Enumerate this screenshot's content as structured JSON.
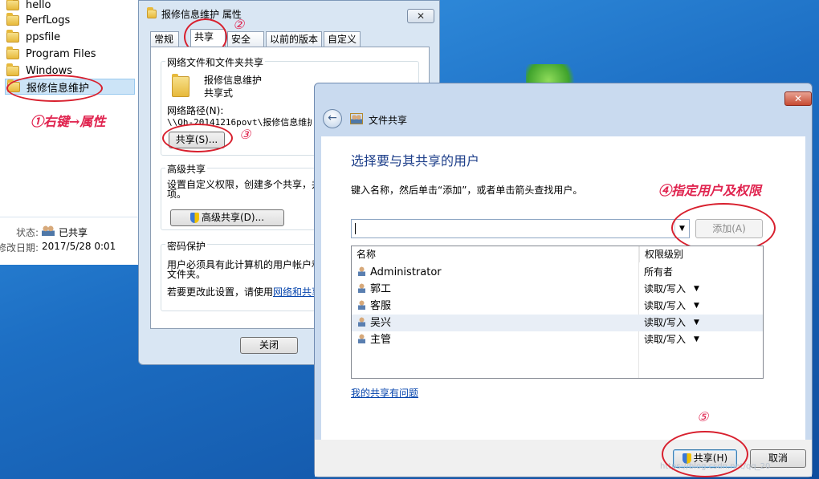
{
  "explorer": {
    "items": [
      {
        "label": "hello"
      },
      {
        "label": "PerfLogs"
      },
      {
        "label": "ppsfile"
      },
      {
        "label": "Program Files"
      },
      {
        "label": "Windows"
      },
      {
        "label": "报修信息维护"
      }
    ],
    "annotation_step1": "①右键→属性",
    "status_label": "状态:",
    "status_value": "已共享",
    "modified_label": "修改日期:",
    "modified_value": "2017/5/28 0:01"
  },
  "properties": {
    "title": "报修信息维护 属性",
    "close_x": "✕",
    "tabs": [
      {
        "label": "常规"
      },
      {
        "label": "共享"
      },
      {
        "label": "安全"
      },
      {
        "label": "以前的版本"
      },
      {
        "label": "自定义"
      }
    ],
    "annotation_step2": "②",
    "network_group_title": "网络文件和文件夹共享",
    "folder_name": "报修信息维护",
    "folder_state": "共享式",
    "network_path_label": "网络路径(N):",
    "network_path_value": "\\\\Qh-20141216povt\\报修信息维护",
    "share_button": "共享(S)...",
    "annotation_step3": "③",
    "advanced_group_title": "高级共享",
    "advanced_desc_1": "设置自定义权限，创建多个共享，并",
    "advanced_desc_2": "项。",
    "advanced_button": "高级共享(D)...",
    "password_group_title": "密码保护",
    "password_desc_1": "用户必须具有此计算机的用户帐户和",
    "password_desc_2": "文件夹。",
    "password_change_prefix": "若要更改此设置，请使用",
    "password_change_link": "网络和共享",
    "close_button": "关闭"
  },
  "share_dialog": {
    "close_x": "✕",
    "back_icon_glyph": "←",
    "title": "文件共享",
    "heading": "选择要与其共享的用户",
    "instruction": "键入名称，然后单击“添加”，或者单击箭头查找用户。",
    "annotation_step4": "④指定用户及权限",
    "input_value": "",
    "dropdown_glyph": "▼",
    "add_button": "添加(A)",
    "columns": [
      "名称",
      "权限级别"
    ],
    "rows": [
      {
        "name": "Administrator",
        "permission": "所有者",
        "has_dropdown": false
      },
      {
        "name": "郭工",
        "permission": "读取/写入",
        "has_dropdown": true
      },
      {
        "name": "客服",
        "permission": "读取/写入",
        "has_dropdown": true
      },
      {
        "name": "吴兴",
        "permission": "读取/写入",
        "has_dropdown": true
      },
      {
        "name": "主管",
        "permission": "读取/写入",
        "has_dropdown": true
      }
    ],
    "trouble_link": "我的共享有问题",
    "annotation_step5": "⑤",
    "share_button": "共享(H)",
    "cancel_button": "取消",
    "watermark": "https://blog.csdn.net/qq_20"
  },
  "colors": {
    "annotation_red": "#d8202e",
    "link_blue": "#0645ad",
    "heading_blue": "#1e3f8a"
  }
}
